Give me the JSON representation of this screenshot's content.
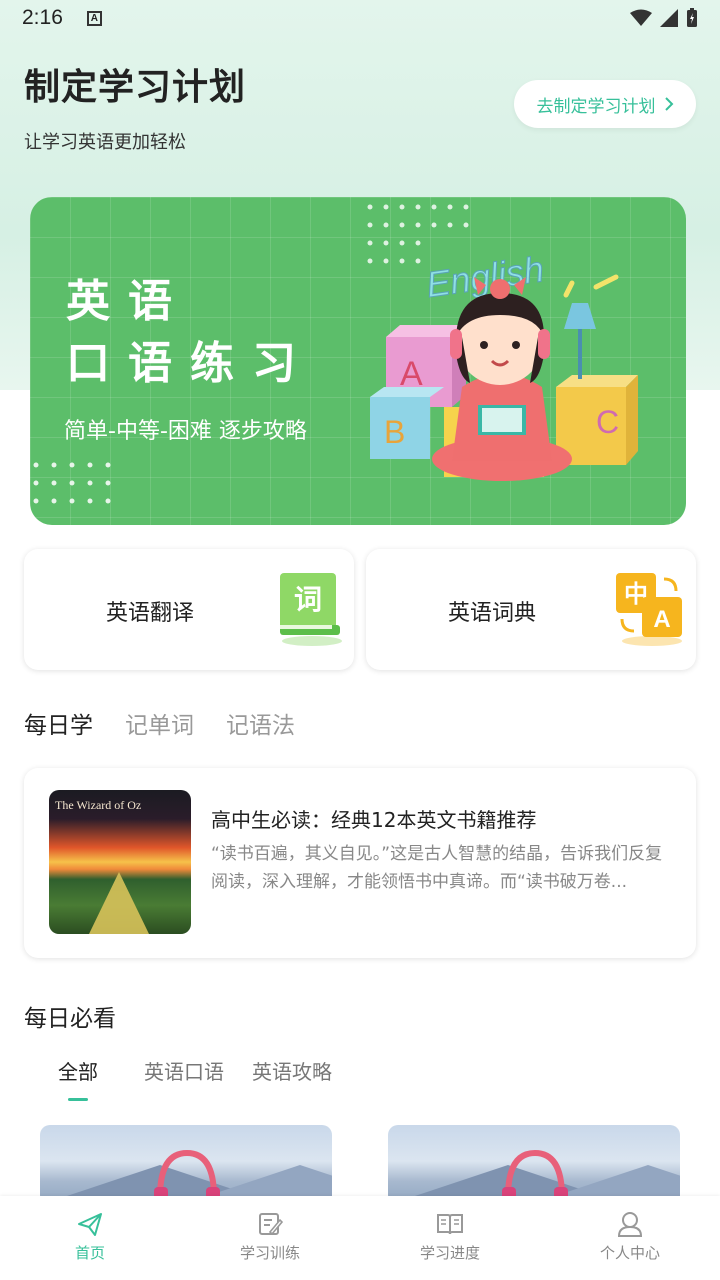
{
  "status": {
    "time": "2:16",
    "notif": "A"
  },
  "plan": {
    "title": "制定学习计划",
    "subtitle": "让学习英语更加轻松",
    "button": "去制定学习计划"
  },
  "banner": {
    "line1": "英语",
    "line2": "口语练习",
    "sub": "简单-中等-困难 逐步攻略",
    "art_text": "English"
  },
  "quick": [
    {
      "label": "英语翻译",
      "icon": "词"
    },
    {
      "label": "英语词典",
      "icon_zh": "中",
      "icon_en": "A"
    }
  ],
  "tabs": [
    "每日学",
    "记单词",
    "记语法"
  ],
  "article": {
    "cover_title": "The Wizard of Oz",
    "title": "高中生必读：经典12本英文书籍推荐",
    "desc": "“读书百遍，其义自见。”这是古人智慧的结晶，告诉我们反复阅读，深入理解，才能领悟书中真谛。而“读书破万卷..."
  },
  "must": {
    "title": "每日必看",
    "tabs": [
      "全部",
      "英语口语",
      "英语攻略"
    ]
  },
  "nav": [
    {
      "label": "首页",
      "icon": "paper-plane-icon"
    },
    {
      "label": "学习训练",
      "icon": "edit-note-icon"
    },
    {
      "label": "学习进度",
      "icon": "book-icon"
    },
    {
      "label": "个人中心",
      "icon": "user-icon"
    }
  ],
  "colors": {
    "accent": "#37c09a",
    "banner": "#5cbe6a",
    "icon_green": "#7ed15a",
    "icon_orange": "#f6b51e"
  }
}
